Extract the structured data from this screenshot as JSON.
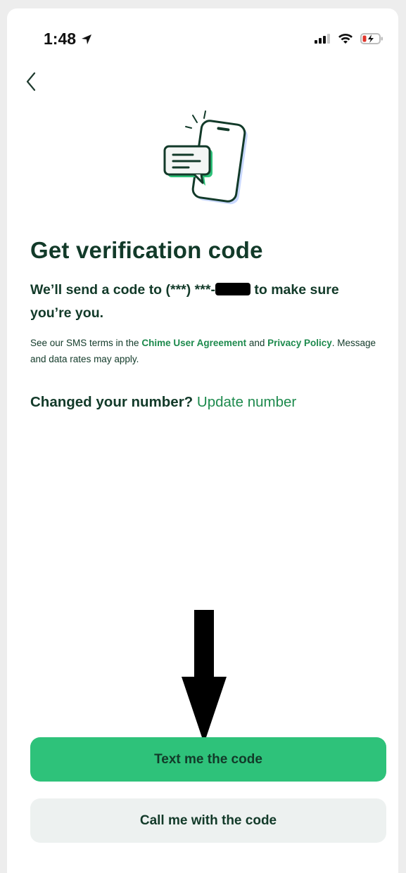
{
  "status_bar": {
    "time": "1:48"
  },
  "content": {
    "title": "Get verification code",
    "subtitle_prefix": "We’ll send a code to (***) ***-",
    "subtitle_suffix": " to make sure you’re you.",
    "legal_prefix": "See our SMS terms in the ",
    "legal_link_agreement": "Chime User Agreement",
    "legal_and": " and ",
    "legal_link_privacy": "Privacy Policy",
    "legal_suffix": ". Message and data rates may apply.",
    "changed_number_label": "Changed your number? ",
    "update_number_link": "Update number"
  },
  "actions": {
    "primary_label": "Text me the code",
    "secondary_label": "Call me with the code"
  },
  "colors": {
    "brand_green": "#2ec27a",
    "dark_text": "#123a29",
    "link_green": "#1d8a4d",
    "secondary_button": "#edf1f0"
  },
  "icons": [
    "location-arrow-icon",
    "signal-icon",
    "wifi-icon",
    "battery-charging-icon",
    "back-chevron-icon",
    "phone-message-illustration",
    "down-arrow-annotation"
  ]
}
